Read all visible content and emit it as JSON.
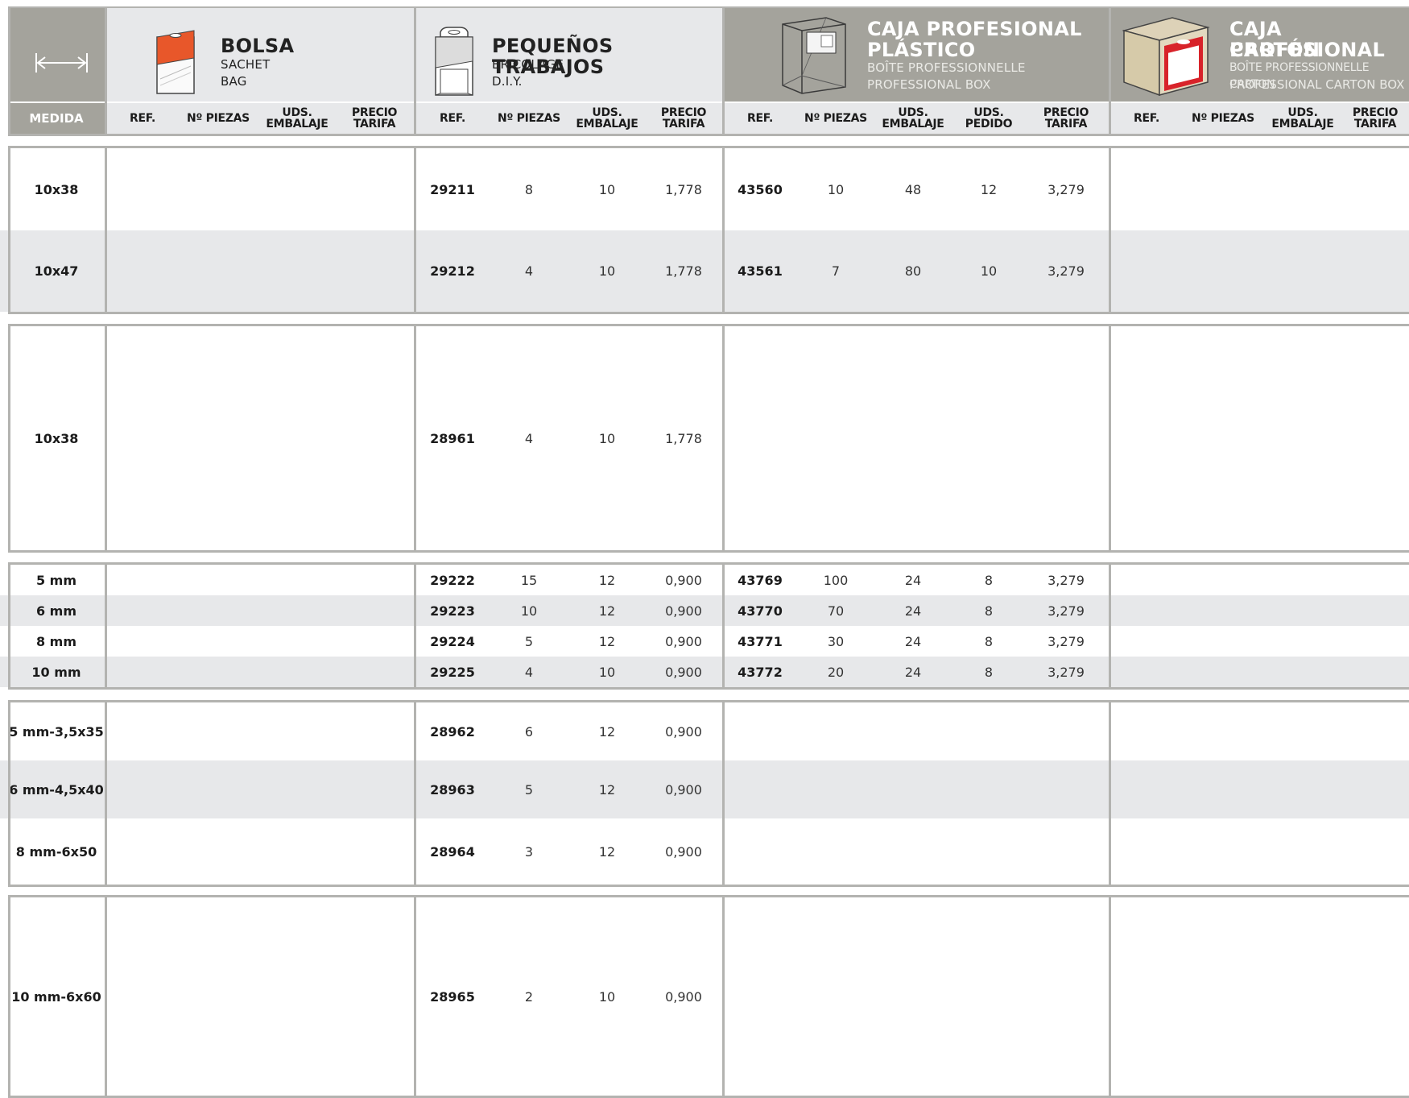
{
  "header": {
    "medida_label": "MEDIDA",
    "sections": [
      {
        "id": "bolsa",
        "title": "BOLSA",
        "sub1": "SACHET",
        "sub2": "BAG",
        "cols": [
          {
            "l1": "REF.",
            "l2": ""
          },
          {
            "l1": "Nº PIEZAS",
            "l2": ""
          },
          {
            "l1": "UDS.",
            "l2": "EMBALAJE"
          },
          {
            "l1": "PRECIO",
            "l2": "TARIFA"
          }
        ]
      },
      {
        "id": "pequenos",
        "title": "PEQUEÑOS TRABAJOS",
        "sub1": "BRICOLAGE",
        "sub2": "D.I.Y.",
        "cols": [
          {
            "l1": "REF.",
            "l2": ""
          },
          {
            "l1": "Nº PIEZAS",
            "l2": ""
          },
          {
            "l1": "UDS.",
            "l2": "EMBALAJE"
          },
          {
            "l1": "PRECIO",
            "l2": "TARIFA"
          }
        ]
      },
      {
        "id": "plastico",
        "title1": "CAJA PROFESIONAL",
        "title2": "PLÁSTICO",
        "sub1": "BOÎTE PROFESSIONNELLE",
        "sub2": "PROFESSIONAL BOX",
        "cols": [
          {
            "l1": "REF.",
            "l2": ""
          },
          {
            "l1": "Nº PIEZAS",
            "l2": ""
          },
          {
            "l1": "UDS.",
            "l2": "EMBALAJE"
          },
          {
            "l1": "UDS.",
            "l2": "PEDIDO"
          },
          {
            "l1": "PRECIO",
            "l2": "TARIFA"
          }
        ]
      },
      {
        "id": "carton",
        "title1": "CAJA PROFESIONAL",
        "title2": "CARTÓN",
        "sub1": "BOÎTE PROFESSIONNELLE CARTON",
        "sub2": "PROFESSIONAL CARTON BOX",
        "cols": [
          {
            "l1": "REF.",
            "l2": ""
          },
          {
            "l1": "Nº PIEZAS",
            "l2": ""
          },
          {
            "l1": "UDS.",
            "l2": "EMBALAJE"
          },
          {
            "l1": "PRECIO",
            "l2": "TARIFA"
          }
        ]
      }
    ],
    "icons": {
      "medida": "width-arrows-icon",
      "bolsa": "sachet-bag-icon",
      "pequenos": "diy-blister-icon",
      "plastico": "plastic-box-icon",
      "carton": "carton-box-icon"
    },
    "colors": {
      "header_dark": "#a4a39c",
      "header_light": "#e7e8ea",
      "row_shade": "#e7e8ea",
      "divider": "#b3b3b0",
      "accent_orange": "#e8572a",
      "accent_red": "#d8232a"
    }
  },
  "groups": [
    {
      "rows": [
        {
          "medida": "10x38",
          "shade": false,
          "pt": {
            "ref": "29211",
            "piezas": "8",
            "emb": "10",
            "precio": "1,778"
          },
          "pl": {
            "ref": "43560",
            "piezas": "10",
            "emb": "48",
            "ped": "12",
            "precio": "3,279"
          }
        },
        {
          "medida": "10x47",
          "shade": true,
          "pt": {
            "ref": "29212",
            "piezas": "4",
            "emb": "10",
            "precio": "1,778"
          },
          "pl": {
            "ref": "43561",
            "piezas": "7",
            "emb": "80",
            "ped": "10",
            "precio": "3,279"
          }
        }
      ]
    },
    {
      "rows": [
        {
          "medida": "10x38",
          "shade": false,
          "pt": {
            "ref": "28961",
            "piezas": "4",
            "emb": "10",
            "precio": "1,778"
          },
          "pl": null
        }
      ]
    },
    {
      "rows": [
        {
          "medida": "5 mm",
          "shade": false,
          "pt": {
            "ref": "29222",
            "piezas": "15",
            "emb": "12",
            "precio": "0,900"
          },
          "pl": {
            "ref": "43769",
            "piezas": "100",
            "emb": "24",
            "ped": "8",
            "precio": "3,279"
          }
        },
        {
          "medida": "6 mm",
          "shade": true,
          "pt": {
            "ref": "29223",
            "piezas": "10",
            "emb": "12",
            "precio": "0,900"
          },
          "pl": {
            "ref": "43770",
            "piezas": "70",
            "emb": "24",
            "ped": "8",
            "precio": "3,279"
          }
        },
        {
          "medida": "8 mm",
          "shade": false,
          "pt": {
            "ref": "29224",
            "piezas": "5",
            "emb": "12",
            "precio": "0,900"
          },
          "pl": {
            "ref": "43771",
            "piezas": "30",
            "emb": "24",
            "ped": "8",
            "precio": "3,279"
          }
        },
        {
          "medida": "10 mm",
          "shade": true,
          "pt": {
            "ref": "29225",
            "piezas": "4",
            "emb": "10",
            "precio": "0,900"
          },
          "pl": {
            "ref": "43772",
            "piezas": "20",
            "emb": "24",
            "ped": "8",
            "precio": "3,279"
          }
        }
      ]
    },
    {
      "rows": [
        {
          "medida": "5 mm-3,5x35",
          "shade": false,
          "pt": {
            "ref": "28962",
            "piezas": "6",
            "emb": "12",
            "precio": "0,900"
          },
          "pl": null
        },
        {
          "medida": "6 mm-4,5x40",
          "shade": true,
          "pt": {
            "ref": "28963",
            "piezas": "5",
            "emb": "12",
            "precio": "0,900"
          },
          "pl": null
        },
        {
          "medida": "8 mm-6x50",
          "shade": false,
          "pt": {
            "ref": "28964",
            "piezas": "3",
            "emb": "12",
            "precio": "0,900"
          },
          "pl": null
        }
      ]
    },
    {
      "rows": [
        {
          "medida": "10 mm-6x60",
          "shade": false,
          "pt": {
            "ref": "28965",
            "piezas": "2",
            "emb": "10",
            "precio": "0,900"
          },
          "pl": null
        }
      ]
    }
  ]
}
